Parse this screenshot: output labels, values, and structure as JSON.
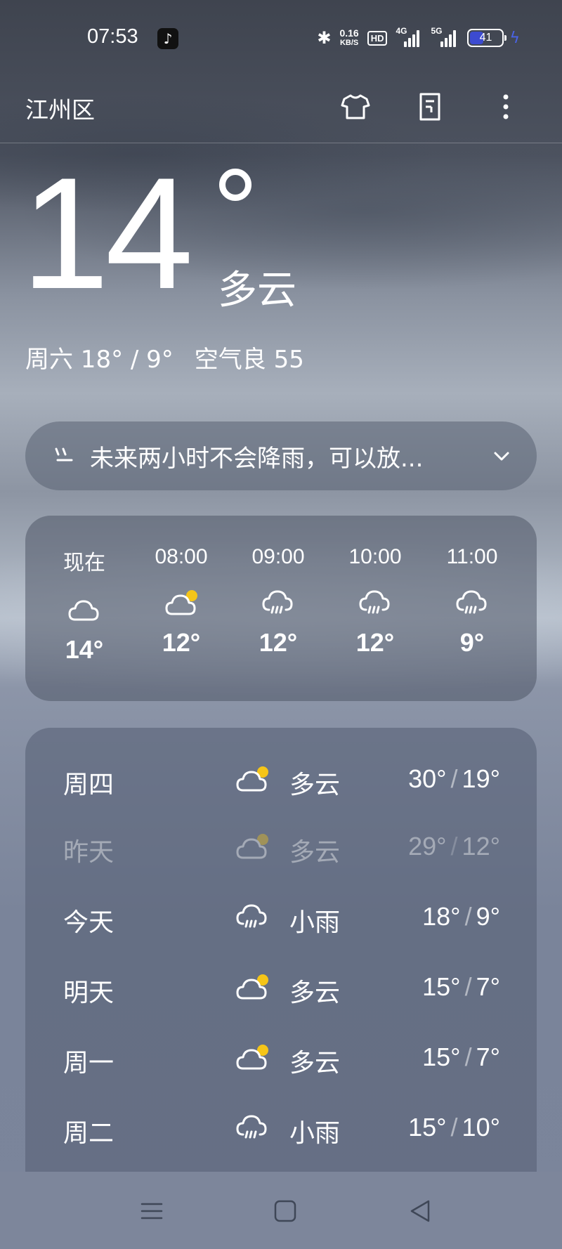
{
  "status_bar": {
    "time": "07:53",
    "net_speed_value": "0.16",
    "net_speed_unit": "KB/S",
    "hd": "HD",
    "sim1_label": "4G",
    "sim2_label": "5G",
    "battery": "41",
    "battery_level_percent": 41
  },
  "header": {
    "location": "江州区",
    "icons": [
      "shirt-icon",
      "document-icon",
      "more-icon"
    ]
  },
  "current": {
    "temp": "14",
    "condition": "多云",
    "day_range": "周六 18° / 9°",
    "air_quality": "空气良 55"
  },
  "rain_alert": {
    "icon": "rain-icon",
    "text": "未来两小时不会降雨，可以放..."
  },
  "hourly": [
    {
      "time": "现在",
      "icon": "cloudy",
      "temp": "14°"
    },
    {
      "time": "08:00",
      "icon": "partly-cloudy",
      "temp": "12°"
    },
    {
      "time": "09:00",
      "icon": "light-rain",
      "temp": "12°"
    },
    {
      "time": "10:00",
      "icon": "light-rain",
      "temp": "12°"
    },
    {
      "time": "11:00",
      "icon": "light-rain",
      "temp": "9°"
    }
  ],
  "daily": [
    {
      "day": "周四",
      "icon": "partly-cloudy",
      "condition": "多云",
      "high": "30°",
      "low": "19°",
      "dim": false
    },
    {
      "day": "昨天",
      "icon": "partly-cloudy",
      "condition": "多云",
      "high": "29°",
      "low": "12°",
      "dim": true
    },
    {
      "day": "今天",
      "icon": "light-rain",
      "condition": "小雨",
      "high": "18°",
      "low": "9°",
      "dim": false
    },
    {
      "day": "明天",
      "icon": "partly-cloudy",
      "condition": "多云",
      "high": "15°",
      "low": "7°",
      "dim": false
    },
    {
      "day": "周一",
      "icon": "partly-cloudy",
      "condition": "多云",
      "high": "15°",
      "low": "7°",
      "dim": false
    },
    {
      "day": "周二",
      "icon": "light-rain",
      "condition": "小雨",
      "high": "15°",
      "low": "10°",
      "dim": false
    }
  ],
  "colors": {
    "sun": "#f5c518",
    "battery_fill": "#3c4bd0",
    "charging": "#4a63e8"
  }
}
